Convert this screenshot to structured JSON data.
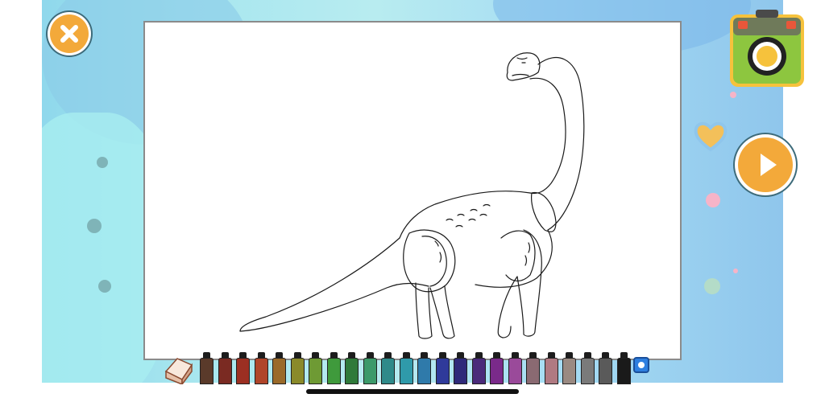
{
  "controls": {
    "close": {
      "icon": "close-icon",
      "color": "#f3a93a"
    },
    "camera": {
      "icon": "camera-icon",
      "color": "#8dc63f"
    },
    "next": {
      "icon": "play-icon",
      "color": "#f3a93a"
    }
  },
  "canvas": {
    "drawing": "brachiosaurus-outline",
    "background": "#ffffff"
  },
  "palette": {
    "tools": [
      "eraser-icon",
      "brush-size-icon"
    ],
    "colors": [
      "#5a3a2a",
      "#7a2a22",
      "#9c2f22",
      "#b0452a",
      "#9a6a2a",
      "#8a8a2a",
      "#6e9a34",
      "#3f9a3c",
      "#2f7a3a",
      "#3c9a6a",
      "#2f8a8a",
      "#2f9aaa",
      "#2f7aaa",
      "#2f3a9a",
      "#2f2a7a",
      "#4a2a7a",
      "#7a2a8a",
      "#9a4a9a",
      "#8a6a72",
      "#b07a82",
      "#9a8a82",
      "#7a7a7a",
      "#5a5a5a",
      "#1a1a1a"
    ],
    "selected_size": "small"
  }
}
